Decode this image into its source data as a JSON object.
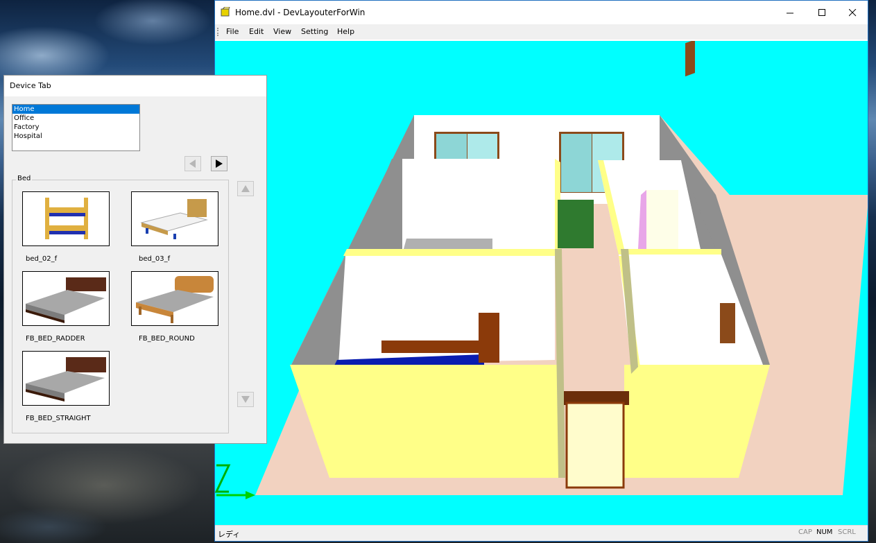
{
  "window": {
    "title": "Home.dvl - DevLayouterForWin",
    "minimize": "—",
    "maximize": "☐",
    "close": "✕"
  },
  "menu": [
    "File",
    "Edit",
    "View",
    "Setting",
    "Help"
  ],
  "status": {
    "text": "レディ",
    "indicators": [
      "CAP",
      "NUM",
      "SCRL"
    ]
  },
  "device_tab": {
    "title": "Device Tab",
    "categories": [
      "Home",
      "Office",
      "Factory",
      "Hospital"
    ],
    "selected_category": "Home",
    "group_label": "Bed",
    "items": [
      {
        "label": "bed_02_f"
      },
      {
        "label": "bed_03_f"
      },
      {
        "label": "FB_BED_RADDER"
      },
      {
        "label": "FB_BED_ROUND"
      },
      {
        "label": "FB_BED_STRAIGHT"
      }
    ]
  },
  "colors": {
    "viewport_bg": "#00ffff",
    "floor": "#f2d2c0",
    "wall_yellow": "#ffff88",
    "accent": "#0078d7"
  }
}
